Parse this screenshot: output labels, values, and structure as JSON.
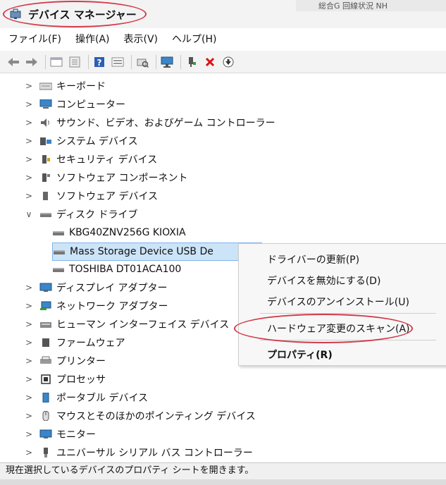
{
  "window": {
    "title": "デバイス マネージャー",
    "background_tab_text": "総合G 回線状況 NH"
  },
  "menubar": {
    "items": [
      "ファイル(F)",
      "操作(A)",
      "表示(V)",
      "ヘルプ(H)"
    ]
  },
  "toolbar": {
    "buttons": [
      "back-icon",
      "forward-icon",
      "properties-icon",
      "window-icon",
      "help-icon",
      "details-icon",
      "scan-icon",
      "monitor-icon",
      "update-driver-icon",
      "uninstall-icon",
      "download-icon"
    ]
  },
  "tree": {
    "items": [
      {
        "label": "キーボード",
        "expanded": false,
        "icon": "keyboard-icon"
      },
      {
        "label": "コンピューター",
        "expanded": false,
        "icon": "computer-icon"
      },
      {
        "label": "サウンド、ビデオ、およびゲーム コントローラー",
        "expanded": false,
        "icon": "sound-icon"
      },
      {
        "label": "システム デバイス",
        "expanded": false,
        "icon": "system-icon"
      },
      {
        "label": "セキュリティ デバイス",
        "expanded": false,
        "icon": "security-icon"
      },
      {
        "label": "ソフトウェア コンポーネント",
        "expanded": false,
        "icon": "software-component-icon"
      },
      {
        "label": "ソフトウェア デバイス",
        "expanded": false,
        "icon": "software-device-icon"
      },
      {
        "label": "ディスク ドライブ",
        "expanded": true,
        "icon": "disk-icon"
      },
      {
        "label": "KBG40ZNV256G KIOXIA",
        "child": true,
        "icon": "drive-icon"
      },
      {
        "label": "Mass Storage Device USB De",
        "child": true,
        "selected": true,
        "icon": "drive-icon"
      },
      {
        "label": "TOSHIBA DT01ACA100",
        "child": true,
        "icon": "drive-icon"
      },
      {
        "label": "ディスプレイ アダプター",
        "expanded": false,
        "icon": "display-icon"
      },
      {
        "label": "ネットワーク アダプター",
        "expanded": false,
        "icon": "network-icon"
      },
      {
        "label": "ヒューマン インターフェイス デバイス",
        "expanded": false,
        "icon": "hid-icon"
      },
      {
        "label": "ファームウェア",
        "expanded": false,
        "icon": "firmware-icon"
      },
      {
        "label": "プリンター",
        "expanded": false,
        "icon": "printer-icon"
      },
      {
        "label": "プロセッサ",
        "expanded": false,
        "icon": "processor-icon"
      },
      {
        "label": "ポータブル デバイス",
        "expanded": false,
        "icon": "portable-icon"
      },
      {
        "label": "マウスとそのほかのポインティング デバイス",
        "expanded": false,
        "icon": "mouse-icon"
      },
      {
        "label": "モニター",
        "expanded": false,
        "icon": "monitor-icon"
      },
      {
        "label": "ユニバーサル シリアル バス コントローラー",
        "expanded": false,
        "icon": "usb-icon"
      }
    ]
  },
  "context_menu": {
    "items": [
      "ドライバーの更新(P)",
      "デバイスを無効にする(D)",
      "デバイスのアンインストール(U)",
      "ハードウェア変更のスキャン(A)",
      "プロパティ(R)"
    ]
  },
  "status_bar": {
    "text": "現在選択しているデバイスのプロパティ シートを開きます。"
  },
  "colors": {
    "annotation_red": "#d23b4a",
    "selection_bg": "#cce4f7",
    "selection_border": "#7eb4ea"
  }
}
